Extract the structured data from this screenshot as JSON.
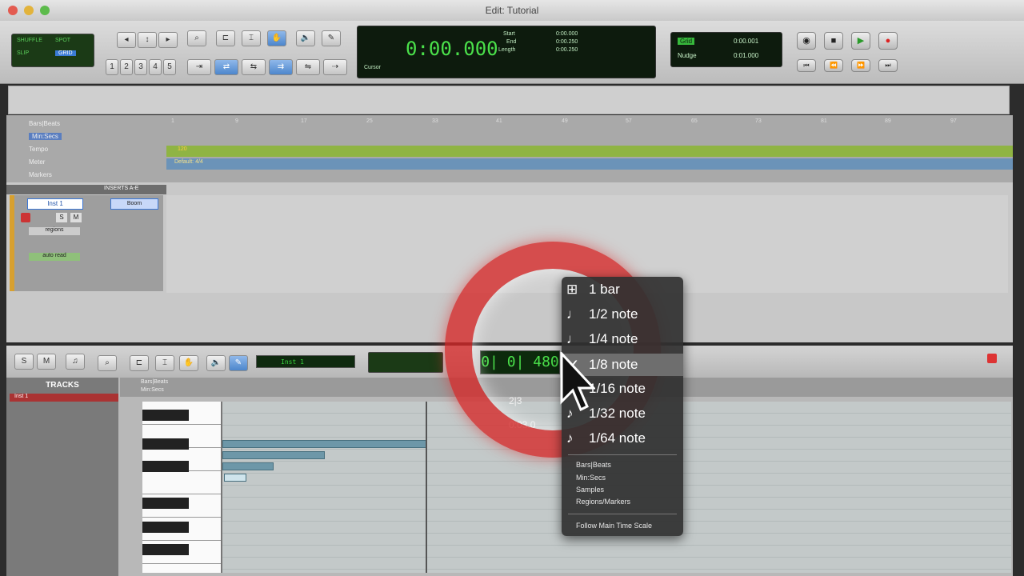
{
  "window": {
    "title": "Edit: Tutorial"
  },
  "transport": {
    "mode_labels": [
      "SHUFFLE",
      "SPOT",
      "SLIP",
      "GRID"
    ],
    "counter_main": "0:00.000",
    "start_label": "Start",
    "end_label": "End",
    "length_label": "Length",
    "start_value": "0:00.000",
    "end_value": "0:00.250",
    "length_value": "0:00.250",
    "cursor_label": "Cursor",
    "grid_label": "Grid",
    "grid_value": "0:00.001",
    "nudge_label": "Nudge",
    "nudge_value": "0:01.000",
    "zoom_presets": [
      "1",
      "2",
      "3",
      "4",
      "5"
    ]
  },
  "rulers": {
    "labels": [
      "Bars|Beats",
      "Min:Secs",
      "Tempo",
      "Meter",
      "Markers"
    ],
    "bar_numbers": [
      "1",
      "9",
      "17",
      "25",
      "33",
      "41",
      "49",
      "57",
      "65",
      "73",
      "81",
      "89",
      "97"
    ],
    "tempo_value": "120",
    "meter_value": "Default: 4/4"
  },
  "edit_track": {
    "inserts_label": "INSERTS A-E",
    "name": "Inst 1",
    "insert_plugin": "Boom",
    "buttons": [
      "S",
      "M"
    ],
    "view_select": "regions",
    "automation": "auto read"
  },
  "midi_editor": {
    "tracks_label": "TRACKS",
    "track_name": "Inst 1",
    "instrument": "Inst 1",
    "lcd_value": "0| 0| 480",
    "ruler_labels": [
      "Bars|Beats",
      "Min:Secs"
    ],
    "ghost_value": "2|3",
    "ghost_time": "0:03.0"
  },
  "popup_menu": {
    "items": [
      {
        "label": "1 bar",
        "icon": "bar-icon",
        "glyph": "⊞"
      },
      {
        "label": "1/2 note",
        "icon": "half-note-icon",
        "glyph": "♩"
      },
      {
        "label": "1/4 note",
        "icon": "quarter-note-icon",
        "glyph": "♩"
      },
      {
        "label": "1/8 note",
        "icon": "eighth-note-icon",
        "glyph": "♪",
        "selected": true
      },
      {
        "label": "1/16 note",
        "icon": "sixteenth-note-icon",
        "glyph": "♪"
      },
      {
        "label": "1/32 note",
        "icon": "thirty-second-note-icon",
        "glyph": "♪"
      },
      {
        "label": "1/64 note",
        "icon": "sixty-fourth-note-icon",
        "glyph": "♪"
      }
    ],
    "small_items": [
      "Bars|Beats",
      "Min:Secs",
      "Samples",
      "Regions/Markers"
    ],
    "footer": "Follow Main Time Scale"
  },
  "colors": {
    "accent_green": "#4ae04a",
    "highlight_red": "#d62828",
    "tempo_green": "#8fb443",
    "meter_blue": "#6b93b8",
    "track_orange": "#d7a030"
  }
}
